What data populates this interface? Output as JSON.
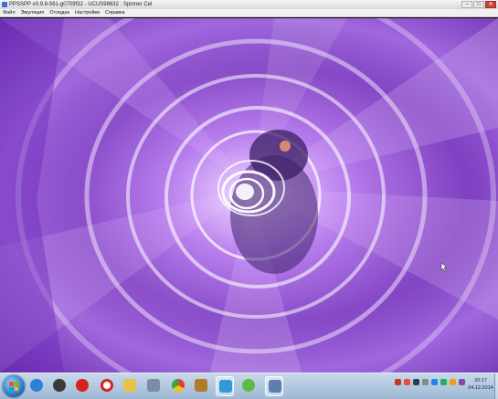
{
  "window": {
    "title": "PPSSPP v0.9.8-561-g0709f32 - UCUS98632 : Spinner Cel",
    "buttons": {
      "minimize": "–",
      "maximize": "□",
      "close": "✕"
    }
  },
  "menu": {
    "items": [
      "Файл",
      "Эмуляция",
      "Отладка",
      "Настройки",
      "Справка"
    ]
  },
  "taskbar": {
    "apps": [
      {
        "name": "internet-explorer",
        "color": "#2f7fd6"
      },
      {
        "name": "media-player",
        "color": "#3a3a3a"
      },
      {
        "name": "opera",
        "color": "#d6231f"
      },
      {
        "name": "explorer-folder",
        "color": "#e6c24a"
      },
      {
        "name": "tool",
        "color": "#7a8fa6"
      },
      {
        "name": "chrome",
        "color": "#e0402d"
      },
      {
        "name": "game",
        "color": "#b07b2a"
      },
      {
        "name": "app",
        "color": "#2f9bd6"
      },
      {
        "name": "torrent",
        "color": "#5fb94a"
      },
      {
        "name": "ppsspp",
        "color": "#5a7fb0"
      }
    ],
    "tray_colors": [
      "#c0392b",
      "#e74c3c",
      "#2c3e50",
      "#7f8c8d",
      "#1e88e5",
      "#27ae60",
      "#f39c12",
      "#8e44ad"
    ],
    "clock": {
      "time": "20:17",
      "date": "04.12.2014"
    }
  }
}
